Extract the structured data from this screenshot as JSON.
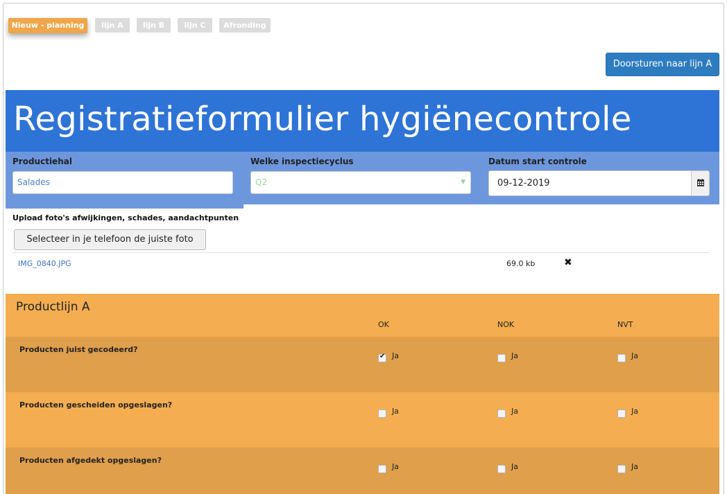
{
  "workflow": {
    "steps": [
      "Nieuw - planning",
      "lijn A",
      "lijn B",
      "lijn C",
      "Afronding"
    ],
    "active_step": "Nieuw - planning",
    "forward_button": "Doorsturen naar lijn A"
  },
  "form": {
    "title": "Registratieformulier hygiënecontrole",
    "fields": {
      "productiehal": {
        "label": "Productiehal",
        "value": "Salades"
      },
      "inspectiecyclus": {
        "label": "Welke inspectiecyclus",
        "value": "Q2"
      },
      "datum": {
        "label": "Datum start controle",
        "value": "09-12-2019"
      }
    },
    "upload": {
      "label": "Upload foto's afwijkingen, schades, aandachtpunten",
      "button": "Selecteer in je telefoon de juiste foto",
      "files": [
        {
          "name": "IMG_0840.JPG",
          "size": "69.0 kb"
        }
      ]
    }
  },
  "section": {
    "title": "Productlijn A",
    "columns": [
      "OK",
      "NOK",
      "NVT"
    ],
    "option_label": "Ja",
    "questions": [
      {
        "text": "Producten juist gecodeerd?",
        "ok": true,
        "nok": false,
        "nvt": false
      },
      {
        "text": "Producten gescheiden opgeslagen?",
        "ok": false,
        "nok": false,
        "nvt": false
      },
      {
        "text": "Producten afgedekt opgeslagen?",
        "ok": false,
        "nok": false,
        "nvt": false
      }
    ]
  },
  "colors": {
    "step_active": "#f0a64a",
    "step_inactive": "#dcdcdc",
    "title_blue": "#2e73d6",
    "field_band": "#6d97dd",
    "button_blue": "#2e7cc0",
    "section_orange": "#f4ad50",
    "section_dark_row": "#df9f4b"
  },
  "icons": {
    "calendar": "calendar-icon",
    "remove": "close-icon",
    "select_caret": "chevron-down-icon"
  }
}
